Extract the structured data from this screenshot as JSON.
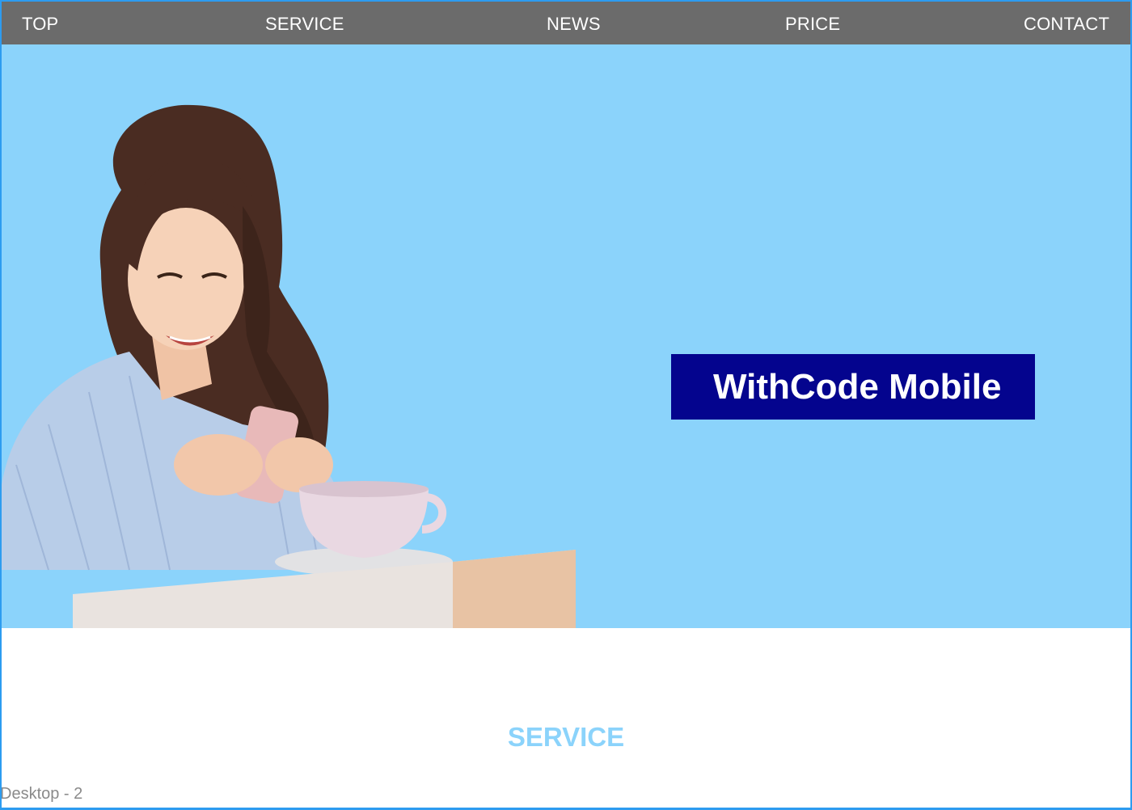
{
  "nav": {
    "items": [
      {
        "label": "TOP"
      },
      {
        "label": "SERVICE"
      },
      {
        "label": "NEWS"
      },
      {
        "label": "PRICE"
      },
      {
        "label": "CONTACT"
      }
    ]
  },
  "hero": {
    "title": "WithCode Mobile",
    "background_color": "#8bd3fb",
    "title_box_color": "#04048e",
    "illustration": "woman-with-phone-and-coffee-image"
  },
  "service_section": {
    "heading": "SERVICE"
  },
  "artboard": {
    "label": "Desktop - 2"
  }
}
